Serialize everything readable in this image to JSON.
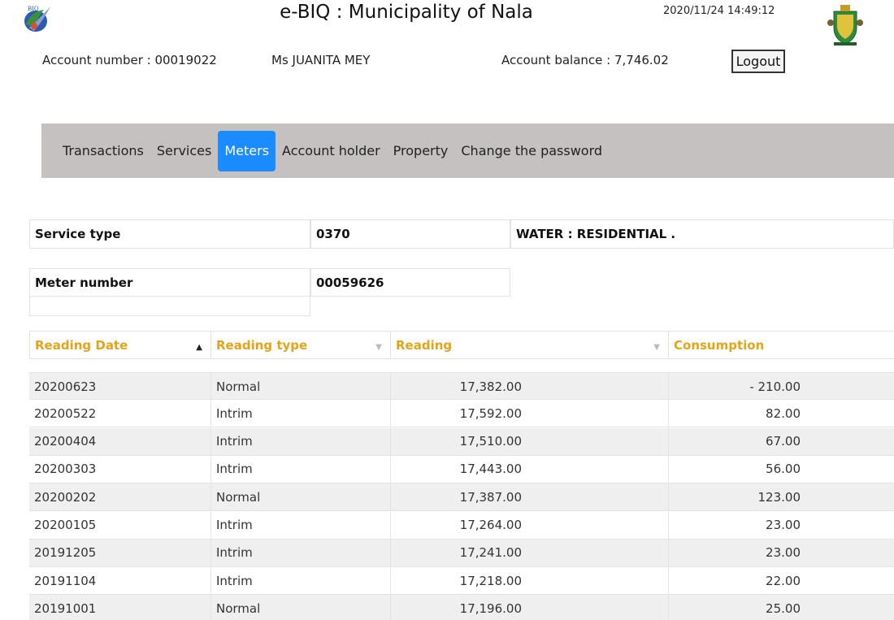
{
  "header": {
    "title": "e-BIQ : Municipality of Nala",
    "timestamp": "2020/11/24 14:49:12",
    "left_logo_text": "BIQ"
  },
  "account": {
    "number_text": "Account number : 00019022",
    "holder_name": "Ms JUANITA MEY",
    "balance_text": "Account balance : 7,746.02",
    "logout_label": "Logout"
  },
  "nav": {
    "items": [
      {
        "label": "Transactions"
      },
      {
        "label": "Services"
      },
      {
        "label": "Meters",
        "active": true
      },
      {
        "label": "Account holder"
      },
      {
        "label": "Property"
      },
      {
        "label": "Change the password"
      }
    ]
  },
  "meter_info": {
    "service_type_label": "Service type",
    "service_type_code": "0370",
    "service_type_desc": "WATER : RESIDENTIAL .",
    "meter_number_label": "Meter number",
    "meter_number_value": "00059626"
  },
  "readings_table": {
    "columns": [
      "Reading Date",
      "Reading type",
      "Reading",
      "Consumption"
    ],
    "rows": [
      {
        "date": "20200623",
        "type": "Normal",
        "reading": "17,382.00",
        "consumption": "- 210.00"
      },
      {
        "date": "20200522",
        "type": "Intrim",
        "reading": "17,592.00",
        "consumption": "82.00"
      },
      {
        "date": "20200404",
        "type": "Intrim",
        "reading": "17,510.00",
        "consumption": "67.00"
      },
      {
        "date": "20200303",
        "type": "Intrim",
        "reading": "17,443.00",
        "consumption": "56.00"
      },
      {
        "date": "20200202",
        "type": "Normal",
        "reading": "17,387.00",
        "consumption": "123.00"
      },
      {
        "date": "20200105",
        "type": "Intrim",
        "reading": "17,264.00",
        "consumption": "23.00"
      },
      {
        "date": "20191205",
        "type": "Intrim",
        "reading": "17,241.00",
        "consumption": "23.00"
      },
      {
        "date": "20191104",
        "type": "Intrim",
        "reading": "17,218.00",
        "consumption": "22.00"
      },
      {
        "date": "20191001",
        "type": "Normal",
        "reading": "17,196.00",
        "consumption": "25.00"
      }
    ]
  },
  "colors": {
    "accent": "#1a8cff",
    "header_text": "#e6a317",
    "nav_bg": "#c4c1c0"
  }
}
